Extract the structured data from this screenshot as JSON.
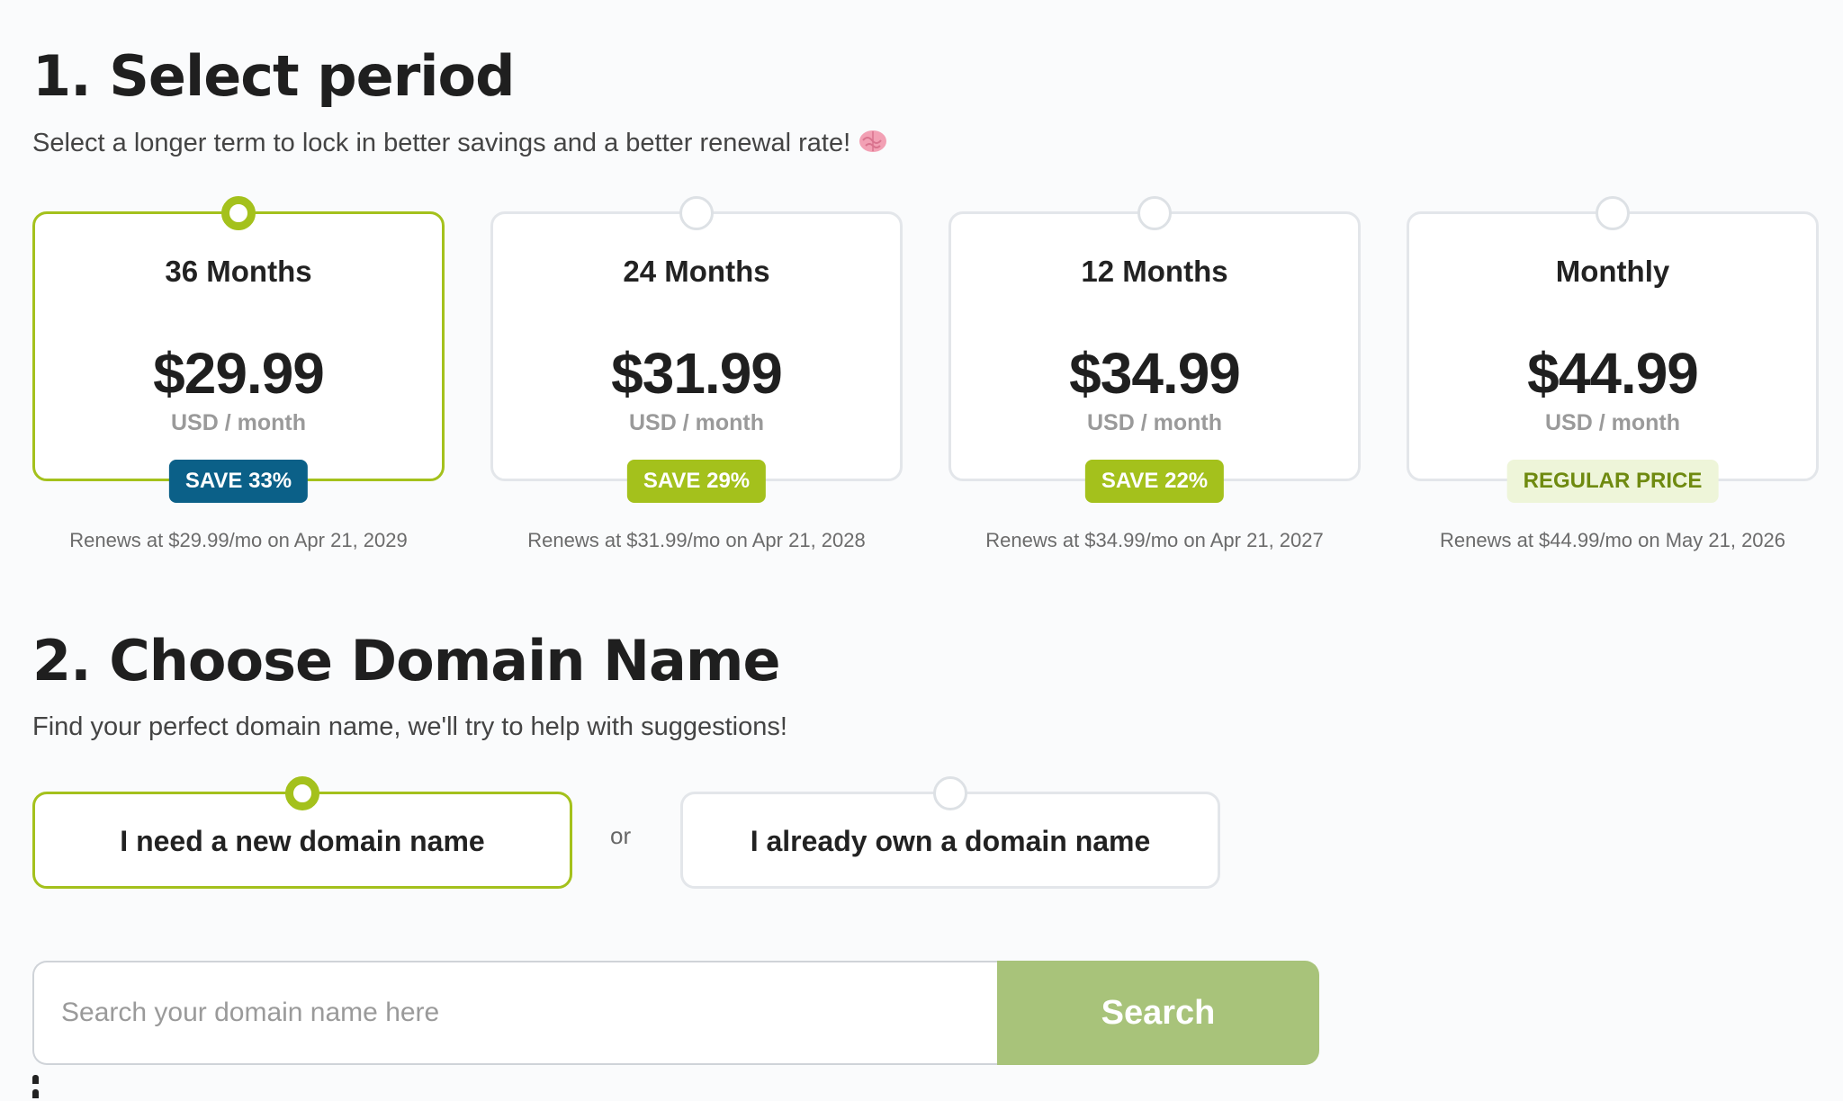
{
  "section1": {
    "title": "1. Select period",
    "subtitle": "Select a longer term to lock in better savings and a better renewal rate!",
    "emoji_icon": "brain-icon",
    "plans": [
      {
        "title": "36 Months",
        "price": "$29.99",
        "unit": "USD / month",
        "badge": "SAVE 33%",
        "badge_color": "#0b6088",
        "badge_text_color": "#ffffff",
        "renewal": "Renews at $29.99/mo on Apr 21, 2029",
        "selected": true
      },
      {
        "title": "24 Months",
        "price": "$31.99",
        "unit": "USD / month",
        "badge": "SAVE 29%",
        "badge_color": "#a4c11c",
        "badge_text_color": "#ffffff",
        "renewal": "Renews at $31.99/mo on Apr 21, 2028",
        "selected": false
      },
      {
        "title": "12 Months",
        "price": "$34.99",
        "unit": "USD / month",
        "badge": "SAVE 22%",
        "badge_color": "#a4c11c",
        "badge_text_color": "#ffffff",
        "renewal": "Renews at $34.99/mo on Apr 21, 2027",
        "selected": false
      },
      {
        "title": "Monthly",
        "price": "$44.99",
        "unit": "USD / month",
        "badge": "REGULAR PRICE",
        "badge_color": "#eef5d9",
        "badge_text_color": "#6f8a10",
        "renewal": "Renews at $44.99/mo on May 21, 2026",
        "selected": false
      }
    ]
  },
  "section2": {
    "title": "2. Choose Domain Name",
    "subtitle": "Find your perfect domain name, we'll try to help with suggestions!",
    "options": [
      {
        "label": "I need a new domain name",
        "selected": true
      },
      {
        "label": "I already own a domain name",
        "selected": false
      }
    ],
    "or_label": "or"
  },
  "search": {
    "placeholder": "Search your domain name here",
    "value": "",
    "button_label": "Search"
  },
  "colors": {
    "accent": "#a4c11c",
    "search_button": "#a8c37a",
    "badge_blue": "#0b6088"
  }
}
